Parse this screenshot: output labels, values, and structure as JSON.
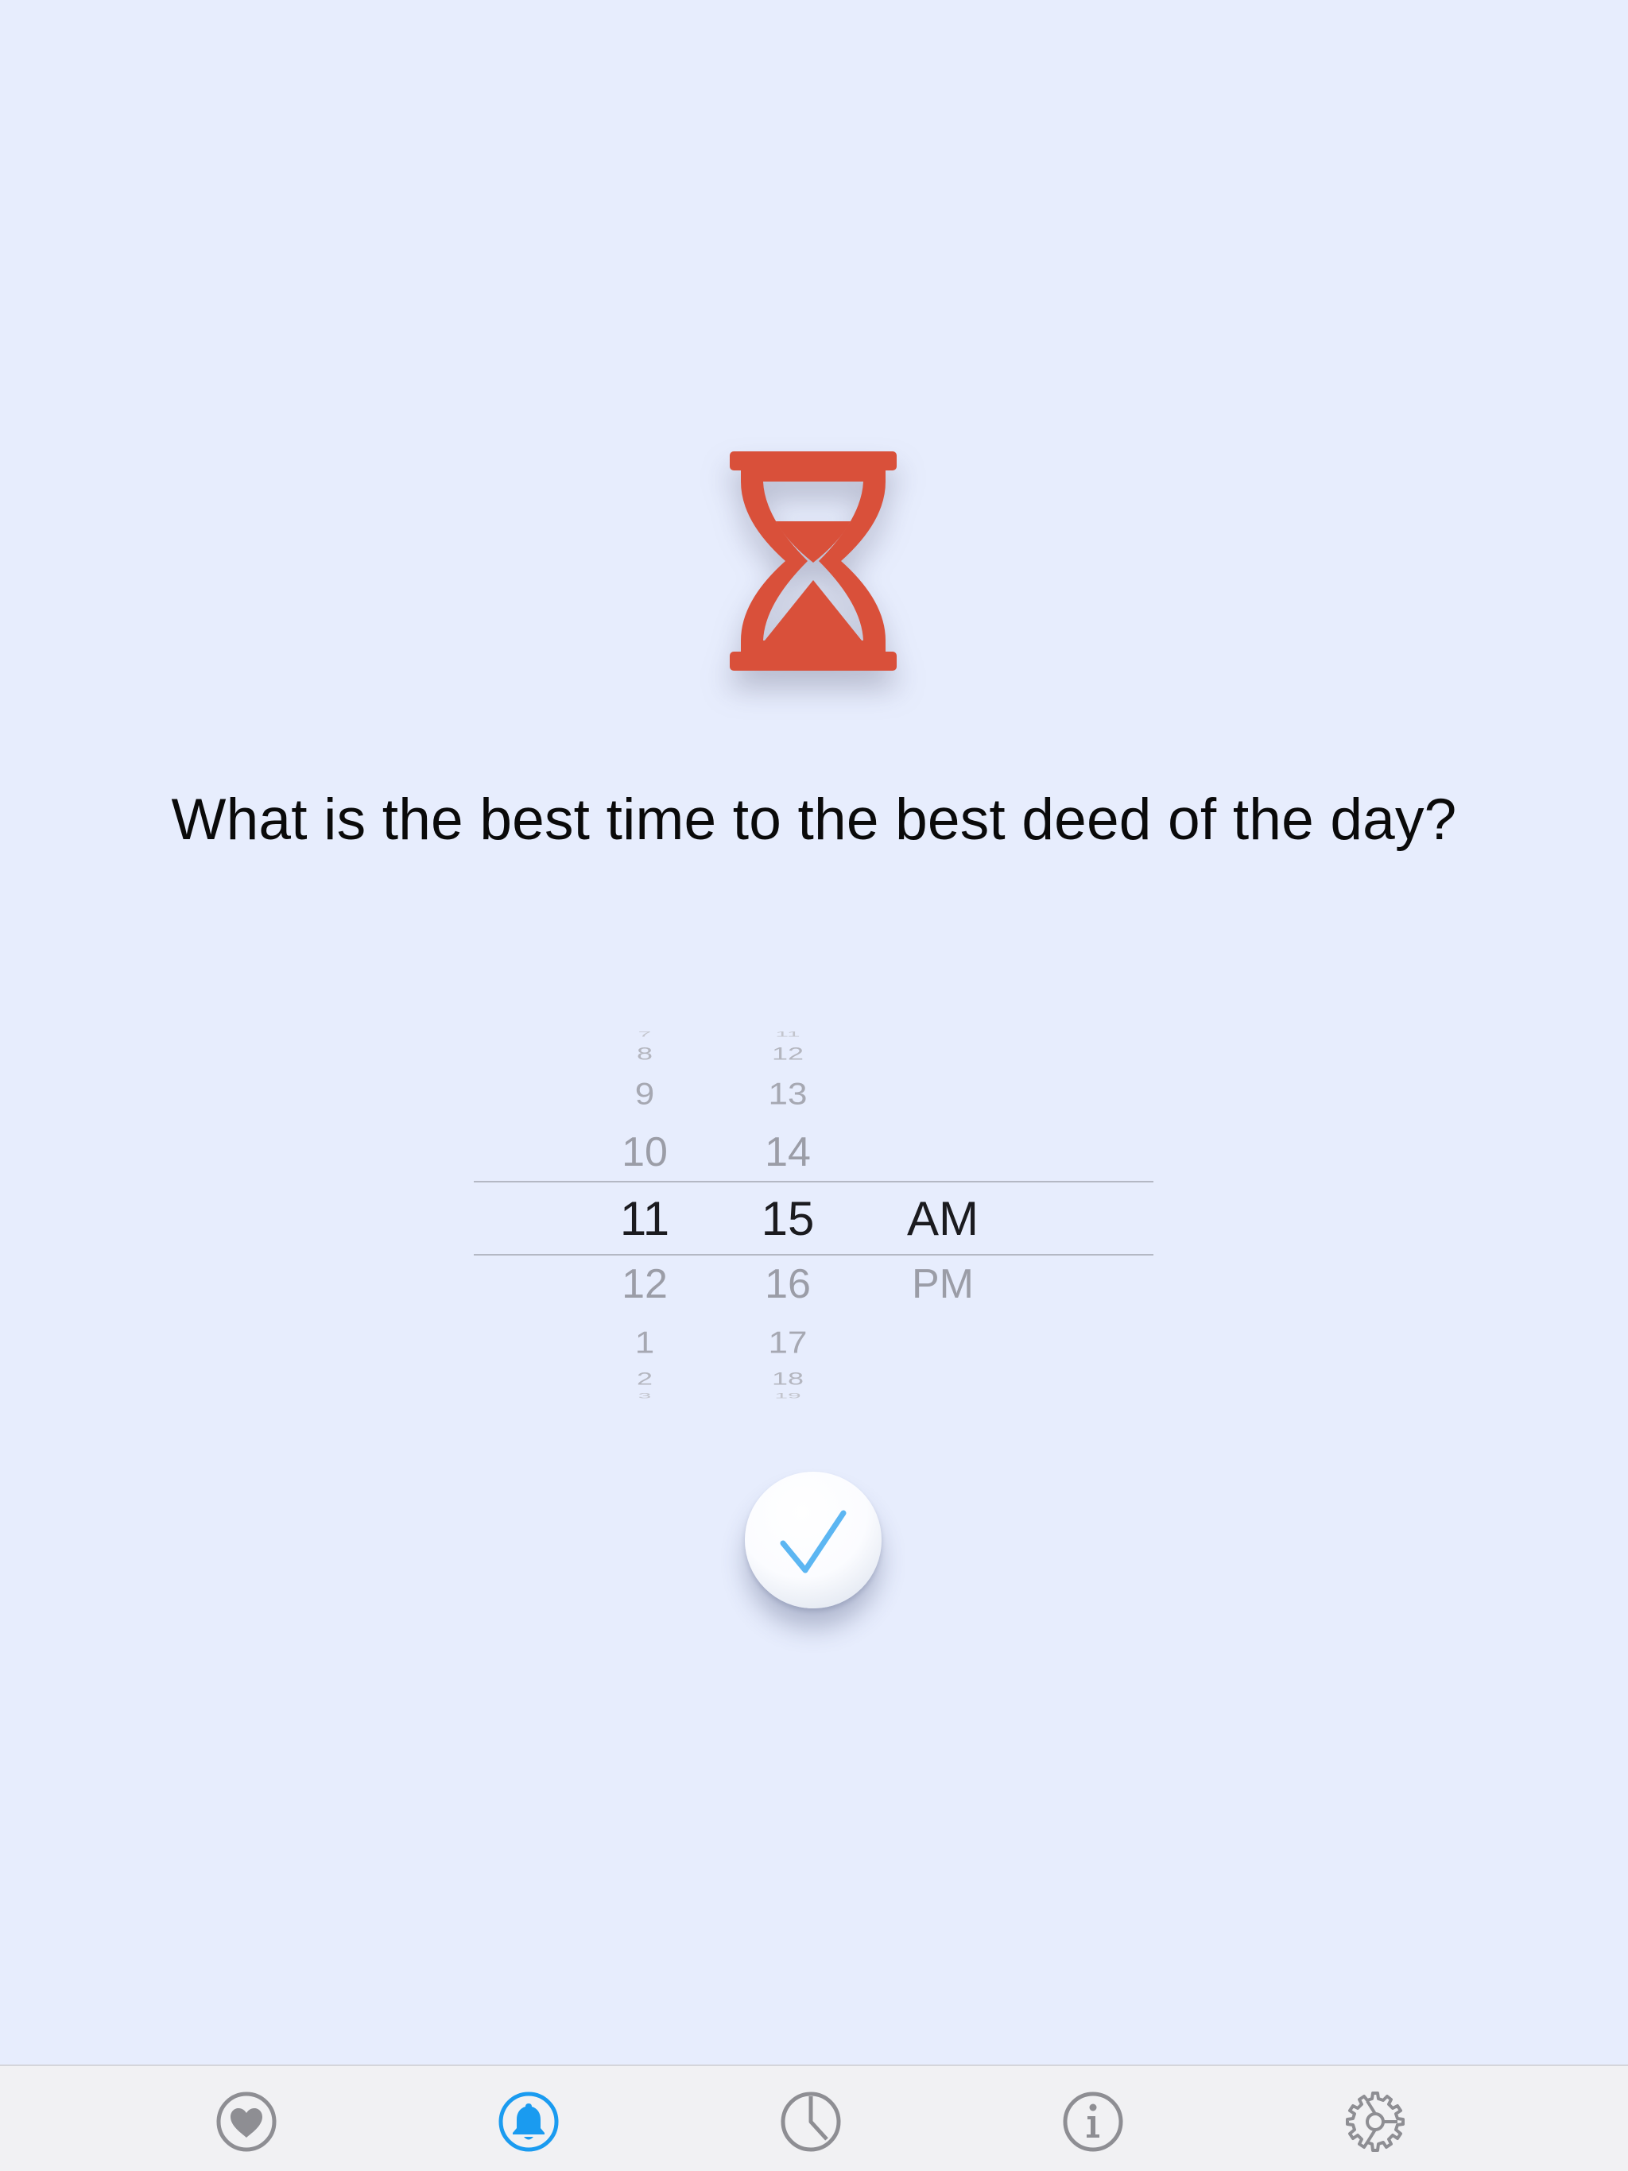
{
  "question": "What is the best time to the best deed of the day?",
  "picker": {
    "hours": {
      "above": [
        "7",
        "8",
        "9",
        "10"
      ],
      "selected": "11",
      "below": [
        "12",
        "1",
        "2",
        "3"
      ]
    },
    "minutes": {
      "above": [
        "11",
        "12",
        "13",
        "14"
      ],
      "selected": "15",
      "below": [
        "16",
        "17",
        "18",
        "19"
      ]
    },
    "period": {
      "selected": "AM",
      "below": [
        "PM"
      ]
    }
  },
  "colors": {
    "background": "#E7EDFD",
    "hourglass": "#D9503A",
    "checkmark": "#5CB6F2",
    "tab_active": "#1A9BF0",
    "tab_inactive": "#8E8E93"
  },
  "tabs": [
    {
      "icon": "heart-icon",
      "active": false
    },
    {
      "icon": "bell-icon",
      "active": true
    },
    {
      "icon": "clock-icon",
      "active": false
    },
    {
      "icon": "info-icon",
      "active": false
    },
    {
      "icon": "gear-icon",
      "active": false
    }
  ]
}
